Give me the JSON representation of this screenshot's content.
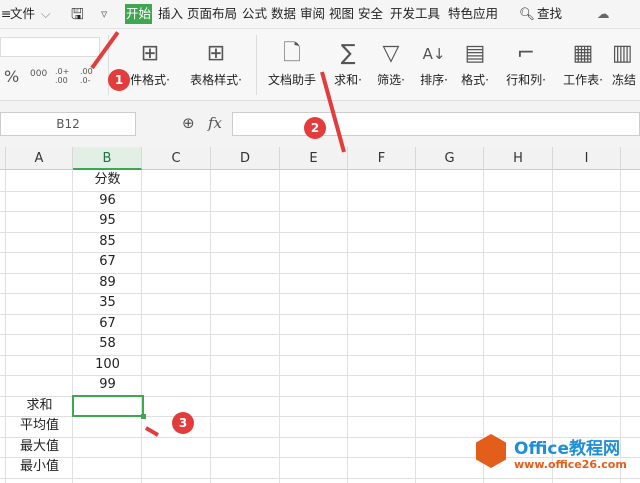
{
  "tabbar": {
    "file": "文件",
    "tabs": [
      "开始",
      "插入",
      "页面布局",
      "公式",
      "数据",
      "审阅",
      "视图",
      "安全",
      "开发工具",
      "特色应用"
    ],
    "active": "开始",
    "search": "查找"
  },
  "ribbon": {
    "items": [
      {
        "icon": "conditional-format-icon",
        "label": "件格式·"
      },
      {
        "icon": "table-style-icon",
        "label": "表格样式·"
      },
      {
        "icon": "doc-assistant-icon",
        "label": "文档助手"
      },
      {
        "icon": "sum-icon",
        "label": "求和·"
      },
      {
        "icon": "filter-icon",
        "label": "筛选·"
      },
      {
        "icon": "sort-icon",
        "label": "排序·"
      },
      {
        "icon": "format-icon",
        "label": "格式·"
      },
      {
        "icon": "row-col-icon",
        "label": "行和列·"
      },
      {
        "icon": "worksheet-icon",
        "label": "工作表·"
      },
      {
        "icon": "freeze-icon",
        "label": "冻结"
      }
    ],
    "number_formats": [
      "%",
      "000",
      ".0+ .00",
      ".00 .0-"
    ]
  },
  "formula_bar": {
    "name_box": "B12",
    "fx": "fx",
    "value": ""
  },
  "columns": [
    "A",
    "B",
    "C",
    "D",
    "E",
    "F",
    "G",
    "H",
    "I"
  ],
  "selected_column": "B",
  "cells": {
    "B": [
      "分数",
      "96",
      "95",
      "85",
      "67",
      "89",
      "35",
      "67",
      "58",
      "100",
      "99",
      "",
      "",
      "",
      ""
    ],
    "A": [
      "",
      "",
      "",
      "",
      "",
      "",
      "",
      "",
      "",
      "",
      "",
      "求和",
      "平均值",
      "最大值",
      "最小值"
    ]
  },
  "markers": [
    "1",
    "2",
    "3"
  ],
  "watermark": {
    "title": "Office教程网",
    "url": "www.office26.com"
  },
  "colors": {
    "accent": "#3fa652",
    "marker": "#e23c3c"
  }
}
